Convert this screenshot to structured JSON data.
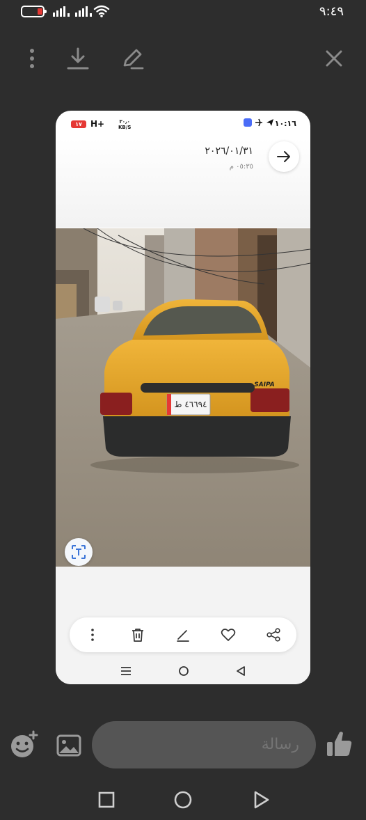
{
  "status_bar": {
    "time": "٩:٤٩"
  },
  "toolbar": {
    "more": "more-vertical-icon",
    "download": "download-icon",
    "edit": "edit-icon",
    "close": "close-icon"
  },
  "preview": {
    "inner_status": {
      "badge": "١٧",
      "network": "H+",
      "speed_value": "٣٠٫٠",
      "speed_unit": "KB/S",
      "time": "١٠:١٦"
    },
    "date": "٢٠٢٦/٠١/٣١",
    "subtime": "٠٥:٣٥ م",
    "plate_text": "٤٦٦٩٤ ط",
    "car_badge": "SAIPA"
  },
  "composer": {
    "placeholder": "رسالة"
  },
  "colors": {
    "background": "#2d2d2d",
    "car_yellow": "#e2a52a",
    "input_bg": "#555555",
    "accent_red": "#e53935"
  }
}
